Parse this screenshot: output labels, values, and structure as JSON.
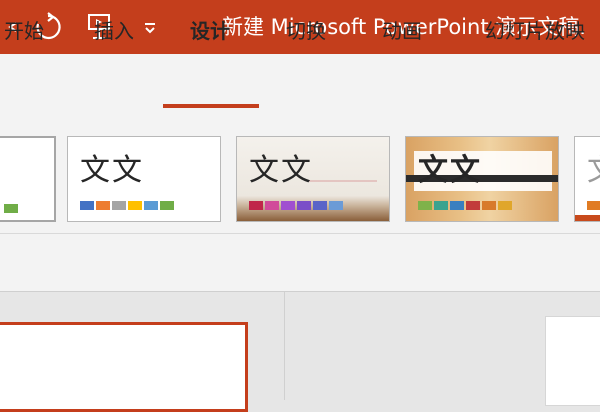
{
  "title_bar": {
    "title": "新建 Microsoft PowerPoint 演示文稿.",
    "qat": [
      {
        "name": "undo-dropdown-icon"
      },
      {
        "name": "redo-icon"
      },
      {
        "name": "present-icon"
      },
      {
        "name": "customize-qat-icon"
      }
    ]
  },
  "tabs": [
    {
      "label": "开始",
      "active": false
    },
    {
      "label": "插入",
      "active": false
    },
    {
      "label": "设计",
      "active": true
    },
    {
      "label": "切换",
      "active": false
    },
    {
      "label": "动画",
      "active": false
    },
    {
      "label": "幻灯片放映",
      "active": false
    }
  ],
  "themes": [
    {
      "name": "current",
      "text": "",
      "swatches": [
        "#70ad47"
      ]
    },
    {
      "name": "office-theme",
      "text": "文文",
      "swatches": [
        "#4472c4",
        "#ed7d31",
        "#a5a5a5",
        "#ffc000",
        "#5b9bd5",
        "#70ad47"
      ]
    },
    {
      "name": "paper-theme",
      "text": "文文",
      "swatches": [
        "#c0264a",
        "#d14a9a",
        "#a04fd0",
        "#7a4ec8",
        "#5a64c8",
        "#6b9bd6"
      ]
    },
    {
      "name": "wood-theme",
      "text": "文文",
      "swatches": [
        "#7fb24a",
        "#3aa38f",
        "#3a7fc0",
        "#c23b3b",
        "#d87a2a",
        "#e0a62a"
      ]
    },
    {
      "name": "partial-theme",
      "text": "文",
      "swatches": [
        "#e07b23"
      ]
    }
  ],
  "colors": {
    "accent": "#c43e1c",
    "ribbon": "#f3f3f3",
    "workspace": "#e6e6e6"
  }
}
